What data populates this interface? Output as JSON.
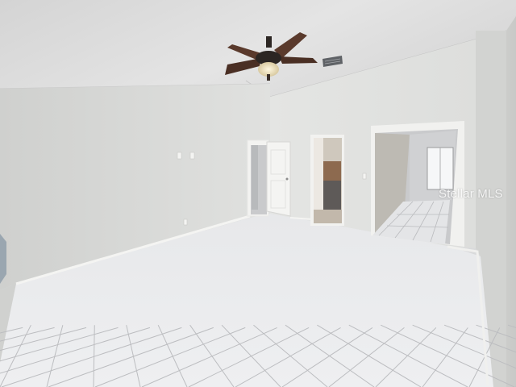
{
  "photo": {
    "watermark": "Stellar MLS",
    "colors": {
      "ceiling": "#dcdcdc",
      "left_wall": "#dadbd9",
      "back_wall": "#e3e4e2",
      "right_wall": "#d3d4d2",
      "floor": "#e9eaec",
      "grout": "#b8b9bc",
      "fan_dark": "#2c2623",
      "fan_blade": "#5a3a2c",
      "door": "#f2f2f0"
    },
    "icons": [
      "ceiling-fan-icon",
      "air-vent-icon",
      "light-switch-icon",
      "outlet-icon"
    ]
  }
}
